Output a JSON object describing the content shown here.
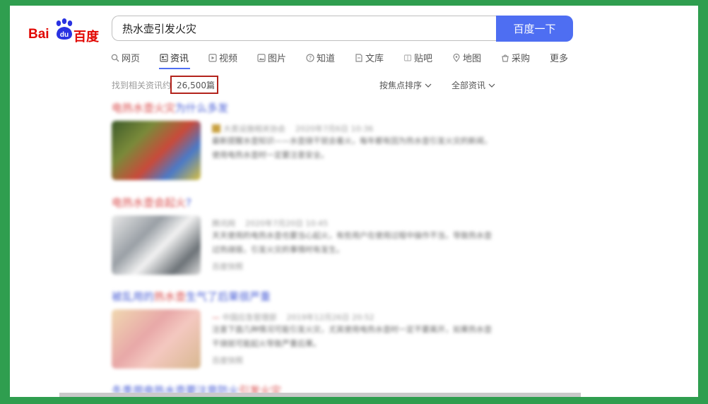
{
  "logo": {
    "part1": "Bai",
    "part2": "百度",
    "paw_text": "du"
  },
  "search": {
    "query": "热水壶引发火灾",
    "button_label": "百度一下"
  },
  "tabs": [
    {
      "label": "网页",
      "icon": "search-icon"
    },
    {
      "label": "资讯",
      "icon": "news-icon",
      "active": true
    },
    {
      "label": "视频",
      "icon": "video-icon"
    },
    {
      "label": "图片",
      "icon": "image-icon"
    },
    {
      "label": "知道",
      "icon": "question-icon"
    },
    {
      "label": "文库",
      "icon": "document-icon"
    },
    {
      "label": "贴吧",
      "icon": "forum-icon"
    },
    {
      "label": "地图",
      "icon": "map-pin-icon"
    },
    {
      "label": "采购",
      "icon": "shopping-icon"
    },
    {
      "label": "更多",
      "icon": ""
    }
  ],
  "results_info": {
    "prefix": "找到相关资讯约",
    "count": "26,500篇"
  },
  "sort_label": "按焦点排序",
  "filter_label": "全部资讯",
  "accent_colors": {
    "search_button": "#4e6ef2",
    "highlight_box": "#b3231c",
    "background": "#2f9e4f"
  },
  "results": [
    {
      "title_red": "电热水壶火灾",
      "title_blue": "为什么多发",
      "source": "大类设施相关协会",
      "date": "2020年7月6日 10:36",
      "snippet": "最新提醒水壶知识——水壶烧干就会着火，每年都有因为热水壶引发火灾的新闻，使用电热水壶时一定要注意安全。"
    },
    {
      "title_red": "电热水壶会起火",
      "title_blue": "?",
      "source": "腾讯网",
      "date": "2020年7月20日 10:45",
      "snippet": "天天使用的电热水壶也要当心起火，有些用户在使用过程中操作不当，导致热水壶过热烧毁，引发火灾的事情时有发生。",
      "extra": "百度快照"
    },
    {
      "title_red": "热水壶",
      "title_blue_pre": "被乱用的",
      "title_blue": "生气了后果很严重",
      "source": "中国应急管理部",
      "date": "2019年12月26日 20:52",
      "snippet": "注意下面几种情况可能引发火灾，尤其使用电热水壶时一定不要离开，如果热水壶干烧就可能起火导致严重后果。",
      "extra": "百度快照"
    },
    {
      "title_blue": "冬季用电热水壶要注意防火",
      "title_red": "引发火灾"
    }
  ]
}
